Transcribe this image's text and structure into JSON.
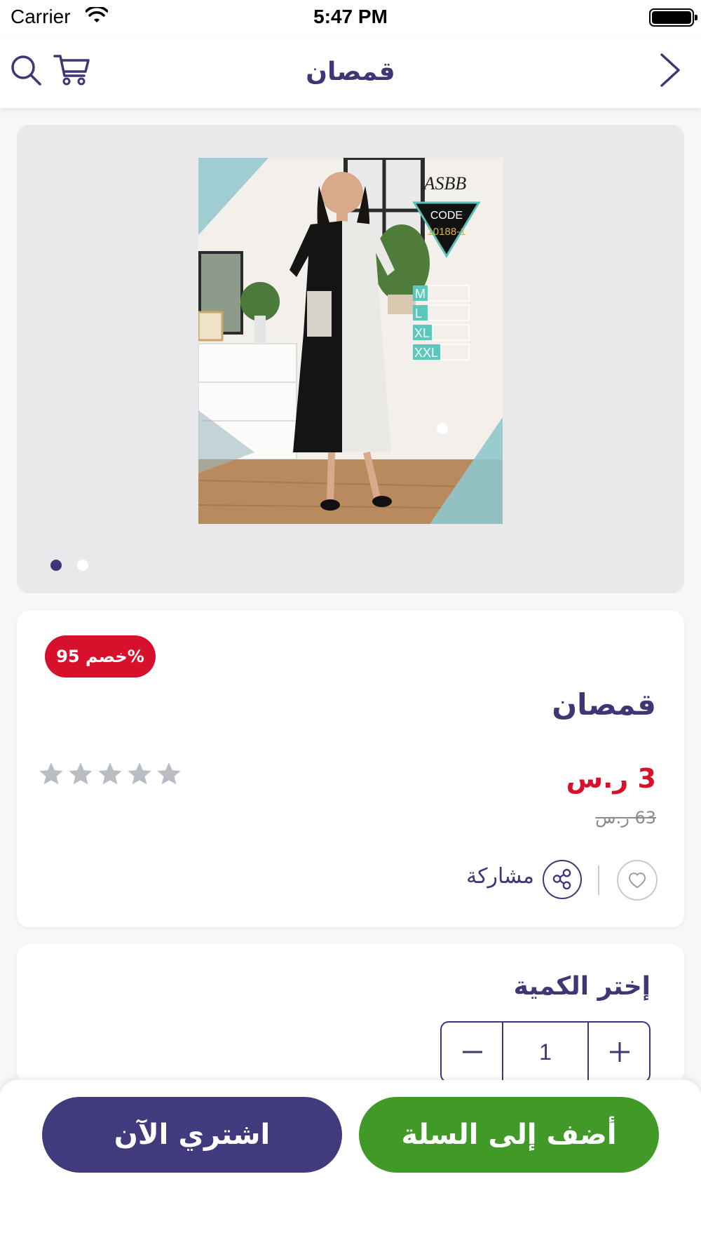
{
  "status_bar": {
    "carrier": "Carrier",
    "time": "5:47 PM"
  },
  "nav": {
    "title": "قمصان",
    "icons": [
      "search-icon",
      "cart-icon",
      "chevron-right-icon"
    ]
  },
  "gallery": {
    "photo_text": {
      "brand": "ASBB",
      "code_label": "CODE",
      "code": "10188-1",
      "sizes": [
        "M",
        "L",
        "XL",
        "XXL"
      ]
    },
    "page_count": 2,
    "current_page": 1
  },
  "product": {
    "discount_badge": "خصم 95%",
    "name": "قمصان",
    "price": "3 ر.س",
    "old_price": "63 ر.س",
    "rating": 0,
    "rating_max": 5,
    "share_label": "مشاركة"
  },
  "quantity": {
    "title": "إختر الكمية",
    "value": "1"
  },
  "actions": {
    "buy_now": "اشتري الآن",
    "add_to_cart": "أضف إلى السلة"
  },
  "colors": {
    "primary": "#3f3676",
    "accent_red": "#d7102b",
    "green": "#419a28",
    "star_empty": "#b9bcc2"
  }
}
